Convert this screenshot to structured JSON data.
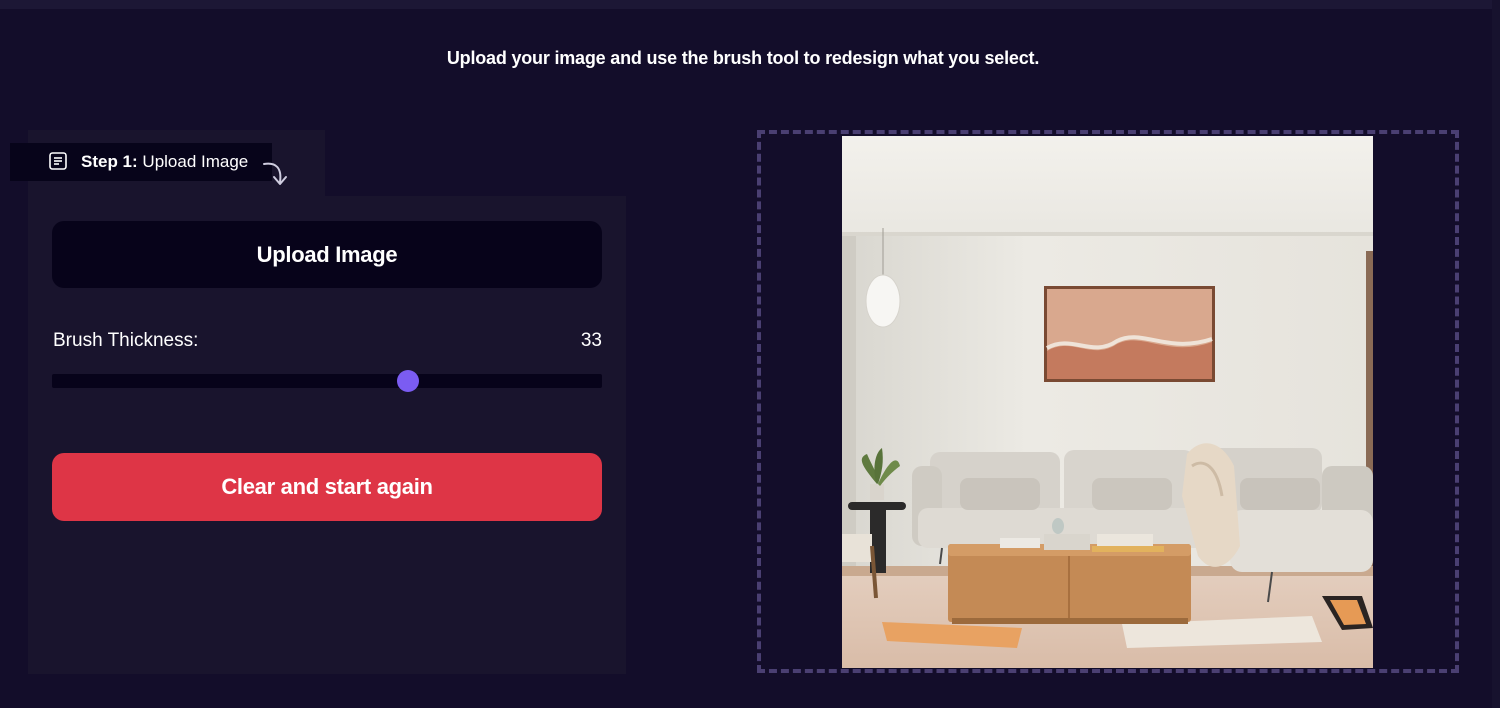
{
  "intro": {
    "text": "Upload your image and use the brush tool to redesign what you select."
  },
  "step": {
    "bold": "Step 1:",
    "label": "Upload Image",
    "icon": "document-icon"
  },
  "controls": {
    "upload_label": "Upload Image",
    "brush_label": "Brush Thickness:",
    "brush_value": "33",
    "brush_fraction": 0.648,
    "clear_label": "Clear and start again"
  },
  "colors": {
    "background": "#130d2a",
    "panel": "#19142d",
    "accent": "#7b5cf2",
    "danger": "#de3546"
  },
  "canvas": {
    "image": "living-room-photo"
  }
}
